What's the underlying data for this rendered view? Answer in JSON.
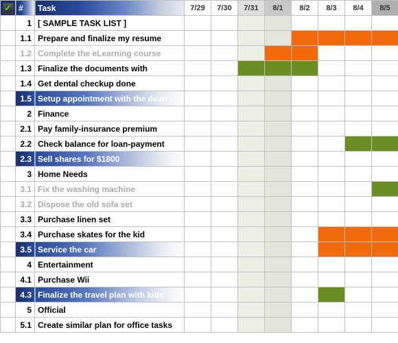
{
  "header": {
    "check_glyph": "✓",
    "num_label": "#",
    "task_label": "Task",
    "days": [
      "7/29",
      "7/30",
      "7/31",
      "8/1",
      "8/2",
      "8/3",
      "8/4",
      "8/5"
    ],
    "day_shading": [
      null,
      null,
      "shade0",
      "shade1",
      null,
      null,
      null,
      "shade2"
    ]
  },
  "body_day_shading": [
    null,
    null,
    "shade0",
    "shade1",
    null,
    null,
    null,
    null
  ],
  "rows": [
    {
      "num": "1",
      "task": "[ SAMPLE TASK LIST ]",
      "style": "normal",
      "bars": []
    },
    {
      "num": "1.1",
      "task": "Prepare and finalize my resume",
      "style": "normal",
      "bars": [
        {
          "start": 4,
          "end": 7,
          "color": "orange"
        }
      ]
    },
    {
      "num": "1.2",
      "task": "Complete the eLearning course",
      "style": "muted",
      "bars": [
        {
          "start": 3,
          "end": 4,
          "color": "orange"
        }
      ]
    },
    {
      "num": "1.3",
      "task": "Finalize the documents with",
      "style": "normal",
      "bars": [
        {
          "start": 2,
          "end": 4,
          "color": "green"
        }
      ]
    },
    {
      "num": "1.4",
      "task": "Get dental checkup done",
      "style": "normal",
      "bars": []
    },
    {
      "num": "1.5",
      "task": "Setup appointment with the dean",
      "style": "highlight",
      "bars": []
    },
    {
      "num": "2",
      "task": "Finance",
      "style": "normal",
      "bars": []
    },
    {
      "num": "2.1",
      "task": "Pay family-insurance premium",
      "style": "normal",
      "bars": []
    },
    {
      "num": "2.2",
      "task": "Check balance for loan-payment",
      "style": "normal",
      "bars": [
        {
          "start": 6,
          "end": 7,
          "color": "green"
        }
      ]
    },
    {
      "num": "2.3",
      "task": "Sell shares for $1800",
      "style": "highlight",
      "bars": []
    },
    {
      "num": "3",
      "task": "Home Needs",
      "style": "normal",
      "bars": []
    },
    {
      "num": "3.1",
      "task": "Fix the washing machine",
      "style": "muted",
      "bars": [
        {
          "start": 7,
          "end": 7,
          "color": "green"
        }
      ]
    },
    {
      "num": "3.2",
      "task": "Dispose the old sofa set",
      "style": "muted",
      "bars": []
    },
    {
      "num": "3.3",
      "task": "Purchase linen set",
      "style": "normal",
      "bars": []
    },
    {
      "num": "3.4",
      "task": "Purchase skates for the kid",
      "style": "normal",
      "bars": [
        {
          "start": 5,
          "end": 7,
          "color": "orange"
        }
      ]
    },
    {
      "num": "3.5",
      "task": "Service the car",
      "style": "highlight",
      "bars": [
        {
          "start": 5,
          "end": 7,
          "color": "orange"
        }
      ]
    },
    {
      "num": "4",
      "task": "Entertainment",
      "style": "normal",
      "bars": []
    },
    {
      "num": "4.1",
      "task": "Purchase Wii",
      "style": "normal",
      "bars": []
    },
    {
      "num": "4.3",
      "task": "Finalize the travel plan with kids",
      "style": "highlight",
      "bars": [
        {
          "start": 5,
          "end": 5,
          "color": "green"
        }
      ]
    },
    {
      "num": "5",
      "task": "Official",
      "style": "normal",
      "bars": []
    },
    {
      "num": "5.1",
      "task": "Create similar plan for office tasks",
      "style": "normal",
      "bars": []
    }
  ]
}
